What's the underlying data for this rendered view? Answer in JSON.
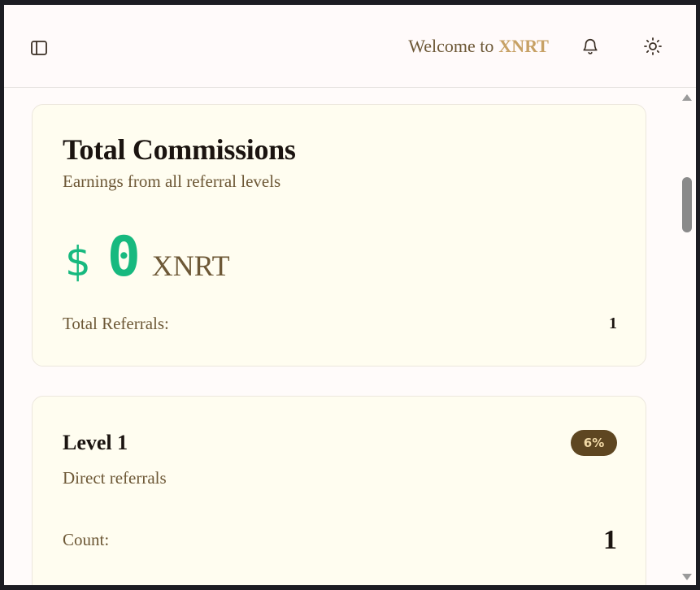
{
  "header": {
    "welcome_prefix": "Welcome to",
    "brand": "XNRT"
  },
  "icons": {
    "sidebar_toggle": "sidebar-panel-icon",
    "notifications": "bell-icon",
    "theme": "sun-icon"
  },
  "total_commissions": {
    "title": "Total Commissions",
    "subtitle": "Earnings from all referral levels",
    "currency_symbol": "$",
    "amount": "0",
    "unit": "XNRT",
    "referrals_label": "Total Referrals:",
    "referrals_value": "1"
  },
  "level_1": {
    "title": "Level 1",
    "badge": "6%",
    "subtitle": "Direct referrals",
    "count_label": "Count:",
    "count_value": "1"
  },
  "colors": {
    "accent_green": "#17b97f",
    "brand_gold": "#c7a165",
    "badge_bg": "#5e4621",
    "text_brown": "#6d5836"
  }
}
